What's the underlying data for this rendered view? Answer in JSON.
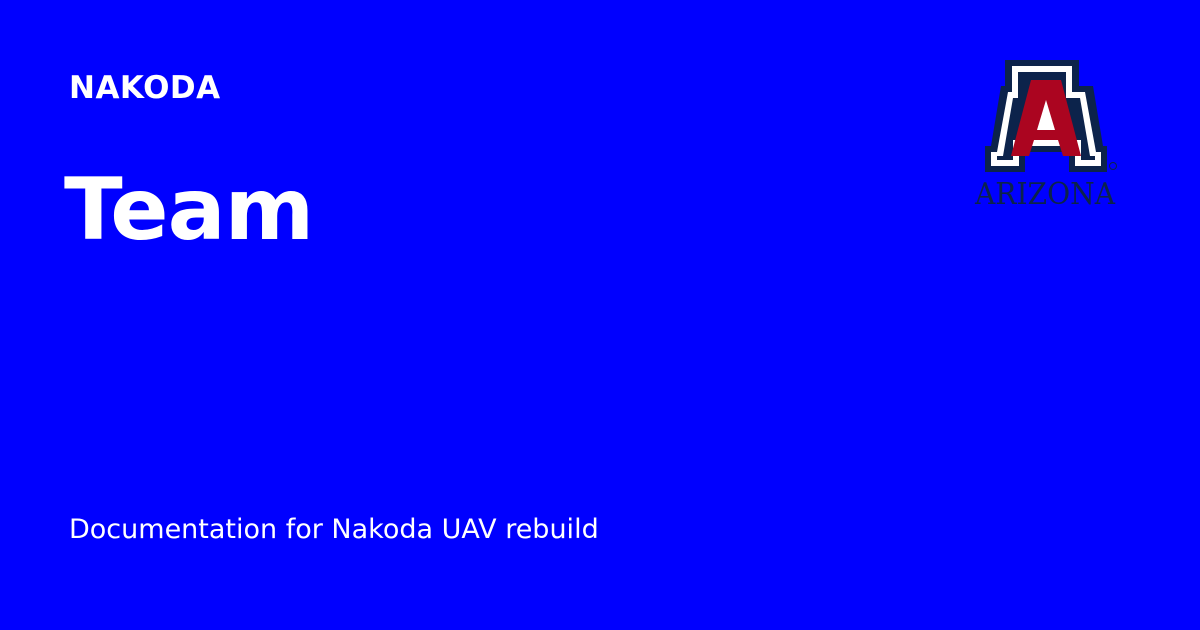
{
  "site": {
    "name": "NAKODA"
  },
  "page": {
    "title": "Team",
    "description": "Documentation for Nakoda UAV rebuild"
  },
  "logo": {
    "icon": "university-of-arizona-a-logo",
    "wordmark": "ARIZONA",
    "navy": "#0c234b",
    "red": "#ab0520",
    "white": "#ffffff"
  },
  "colors": {
    "background": "#0000ff",
    "text": "#ffffff"
  }
}
